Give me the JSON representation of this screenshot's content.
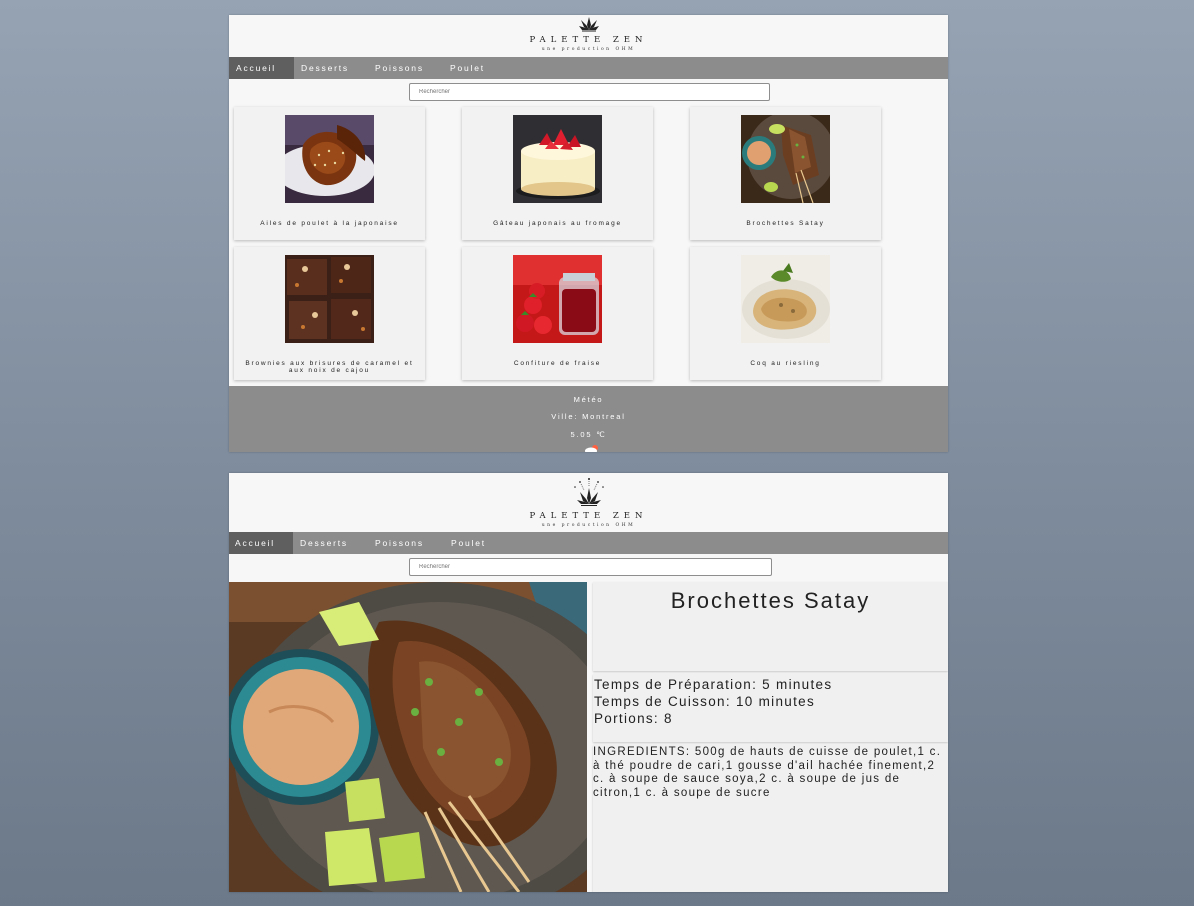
{
  "brand": {
    "name": "PALETTE ZEN",
    "tagline": "une production OHM"
  },
  "nav": {
    "items": [
      {
        "label": "Accueil",
        "active": true
      },
      {
        "label": "Desserts",
        "active": false
      },
      {
        "label": "Poissons",
        "active": false
      },
      {
        "label": "Poulet",
        "active": false
      }
    ]
  },
  "search": {
    "placeholder": "Rechercher"
  },
  "recipes": [
    {
      "title": "Ailes de poulet à la japonaise",
      "image": "chicken-wings-photo"
    },
    {
      "title": "Gâteau japonais au fromage",
      "image": "cheesecake-photo"
    },
    {
      "title": "Brochettes Satay",
      "image": "satay-skewers-photo"
    },
    {
      "title": "Brownies aux brisures de caramel et aux noix de cajou",
      "image": "brownies-photo"
    },
    {
      "title": "Confiture de fraise",
      "image": "strawberry-jam-photo"
    },
    {
      "title": "Coq au riesling",
      "image": "coq-au-riesling-photo"
    }
  ],
  "weather": {
    "heading": "Météo",
    "city": "Ville: Montreal",
    "temperature": "5.05 ℃",
    "icon": "cloud-sun-icon"
  },
  "detail": {
    "title": "Brochettes Satay",
    "prep_time": "Temps de Préparation: 5 minutes",
    "cook_time": "Temps de Cuisson: 10 minutes",
    "portions": "Portions: 8",
    "ingredients": "INGREDIENTS: 500g de hauts de cuisse de poulet,1 c. à thé poudre de cari,1 gousse d'ail hachée finement,2 c. à soupe de sauce soya,2 c. à soupe de jus de citron,1 c. à soupe de sucre"
  },
  "colors": {
    "nav_bg": "#8c8c8c",
    "nav_active": "#5f5f5f",
    "page_bg": "#f7f7f7",
    "card_bg": "#f2f2f2"
  }
}
